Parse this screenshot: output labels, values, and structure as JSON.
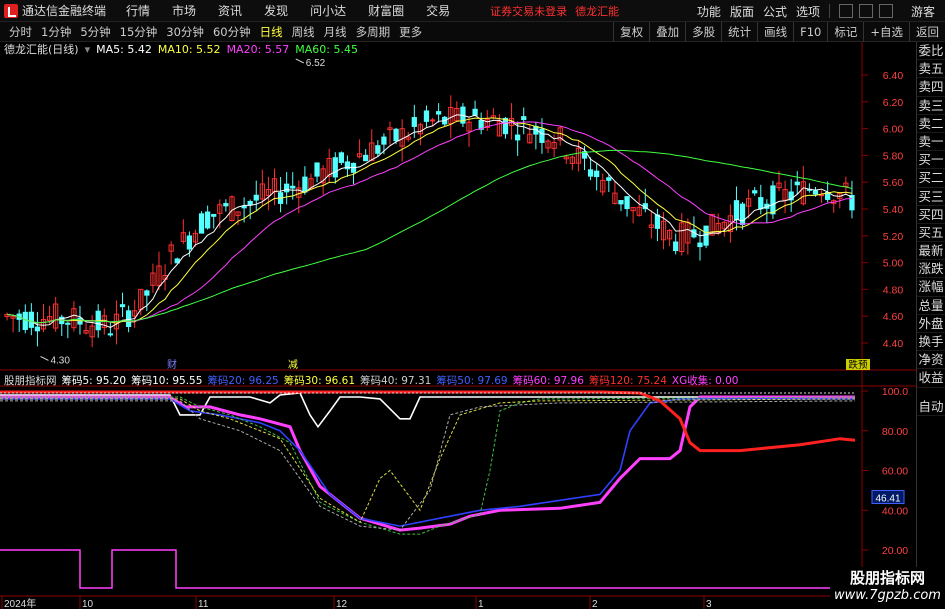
{
  "titlebar": {
    "app_name": "通达信金融终端",
    "menu": [
      "行情",
      "市场",
      "资讯",
      "发现",
      "问小达",
      "财富圈",
      "交易"
    ],
    "warning": "证券交易未登录",
    "stock_name": "德龙汇能",
    "right_items": [
      "功能",
      "版面",
      "公式",
      "选项"
    ],
    "guest": "游客"
  },
  "periods": {
    "items": [
      "分时",
      "1分钟",
      "5分钟",
      "15分钟",
      "30分钟",
      "60分钟",
      "日线",
      "周线",
      "月线",
      "多周期",
      "更多"
    ],
    "active": "日线"
  },
  "toolbar_right": [
    "复权",
    "叠加",
    "多股",
    "统计",
    "画线",
    "F10",
    "标记",
    "+自选",
    "返回"
  ],
  "price_panel": {
    "title": "德龙汇能(日线)",
    "ma5": "MA5: 5.42",
    "ma10": "MA10: 5.52",
    "ma20": "MA20: 5.57",
    "ma60": "MA60: 5.45",
    "high_label": "6.52",
    "low_label": "4.30",
    "y_ticks": [
      "6.40",
      "6.20",
      "6.00",
      "5.80",
      "5.60",
      "5.40",
      "5.20",
      "5.00",
      "4.80",
      "4.60",
      "4.40"
    ],
    "markers": [
      "财",
      "减",
      "跌预"
    ]
  },
  "indicator_panel": {
    "title": "股朋指标网",
    "values": [
      {
        "text": "筹码5: 95.20",
        "color": "#ffffff"
      },
      {
        "text": "筹码10: 95.55",
        "color": "#ffffff"
      },
      {
        "text": "筹码20: 96.25",
        "color": "#4040ff"
      },
      {
        "text": "筹码30: 96.61",
        "color": "#ffff40"
      },
      {
        "text": "筹码40: 97.31",
        "color": "#cccccc"
      },
      {
        "text": "筹码50: 97.69",
        "color": "#4040ff"
      },
      {
        "text": "筹码60: 97.96",
        "color": "#ff40ff"
      },
      {
        "text": "筹码120: 75.24",
        "color": "#ff3030"
      },
      {
        "text": "XG收集: 0.00",
        "color": "#ff40ff"
      }
    ],
    "y_ticks": [
      "100.0",
      "80.00",
      "60.00",
      "40.00",
      "20.00"
    ],
    "current_value": "46.41"
  },
  "x_axis": [
    "2024年",
    "10",
    "11",
    "12",
    "1",
    "2",
    "3"
  ],
  "right_panel": [
    "委比",
    "卖五",
    "卖四",
    "卖三",
    "卖二",
    "卖一",
    "买一",
    "买二",
    "买三",
    "买四",
    "买五",
    "最新",
    "涨跌",
    "涨幅",
    "总量",
    "外盘",
    "换手",
    "净资",
    "收益",
    "自动"
  ],
  "watermark": {
    "line1": "股朋指标网",
    "line2": "www.7gpzb.com"
  },
  "colors": {
    "up": "#ff3030",
    "down": "#54ffff",
    "ma5": "#ffffff",
    "ma10": "#ffff40",
    "ma20": "#ff40ff",
    "ma60": "#40ff40"
  }
}
